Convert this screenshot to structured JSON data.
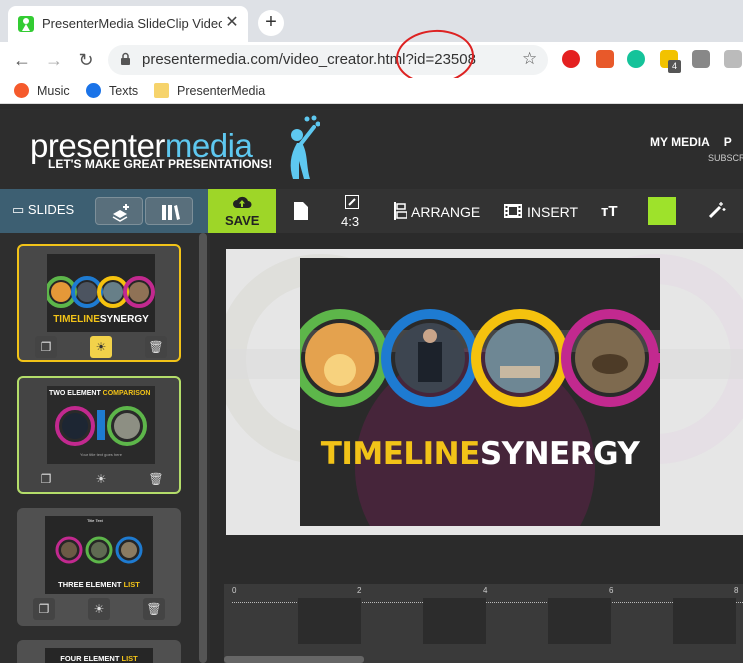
{
  "browser": {
    "tab_title": "PresenterMedia SlideClip Video C",
    "tab_close": "✕",
    "new_tab": "+",
    "url": "presentermedia.com/video_creator.html?id=23508",
    "extension_badge": "4",
    "bookmarks": [
      "Music",
      "Texts",
      "PresenterMedia"
    ]
  },
  "header": {
    "logo_a": "presenter",
    "logo_b": "media",
    "tagline": "LET'S MAKE GREAT PRESENTATIONS!",
    "nav_item": "MY MEDIA",
    "nav_cut": "P",
    "subscr": "SUBSCR"
  },
  "toolbar": {
    "slides": "SLIDES",
    "save": "SAVE",
    "aspect": "4:3",
    "arrange": "ARRANGE",
    "insert": "INSERT",
    "text_icon": "тT",
    "color": "#9ee22b"
  },
  "slides": [
    {
      "title_a": "TIMELINE",
      "title_b": "SYNERGY",
      "selected": true
    },
    {
      "title_a": "TWO ELEMENT ",
      "title_b": "COMPARISON",
      "caption": "Your title text goes here",
      "selected": false
    },
    {
      "label_a": "THREE ELEMENT ",
      "label_b": "LIST",
      "item": "Title Text",
      "selected": false
    },
    {
      "label_a": "FOUR ELEMENT ",
      "label_b": "LIST",
      "selected": false
    }
  ],
  "canvas": {
    "title_a": "TIMELINE",
    "title_b": "SYNERGY"
  },
  "timeline": {
    "ticks": [
      "0",
      "2",
      "4",
      "6",
      "8"
    ]
  },
  "colors": {
    "accent_green": "#9ed628",
    "slide_yellow": "#f2c318",
    "ring_green": "#5db64a",
    "ring_blue": "#1e7bd1",
    "ring_yellow": "#f5c20e",
    "ring_magenta": "#c2298f"
  }
}
